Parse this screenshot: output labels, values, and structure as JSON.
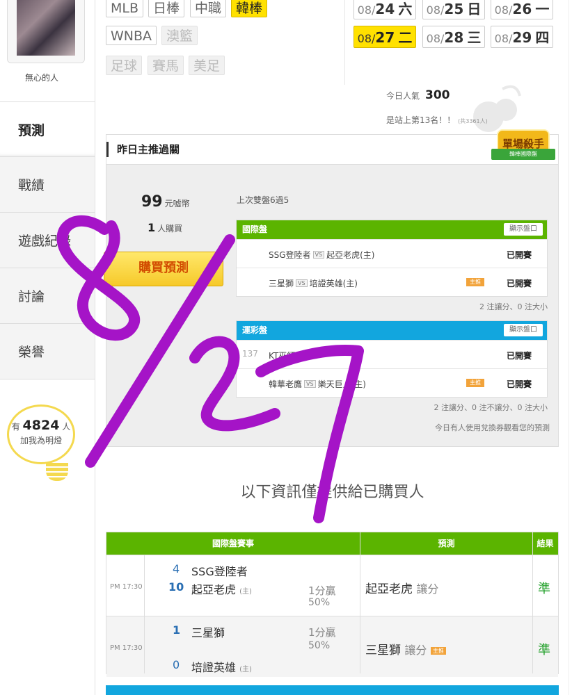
{
  "user": {
    "name": "無心的人"
  },
  "sidebar": {
    "items": [
      {
        "label": "預測"
      },
      {
        "label": "戰績"
      },
      {
        "label": "遊戲紀錄"
      },
      {
        "label": "討論"
      },
      {
        "label": "榮譽"
      }
    ],
    "supporters": {
      "prefix": "有",
      "count": "4824",
      "suffix": "人",
      "text": "加我為明燈"
    }
  },
  "leagues": {
    "row1": [
      "MLB",
      "日棒",
      "中職",
      "韓棒"
    ],
    "row2": [
      "WNBA",
      "澳籃"
    ],
    "row3": [
      "足球",
      "賽馬",
      "美足"
    ],
    "active": "韓棒"
  },
  "dates": [
    {
      "md": "08/",
      "day": "24",
      "wd": "六"
    },
    {
      "md": "08/",
      "day": "25",
      "wd": "日"
    },
    {
      "md": "08/",
      "day": "26",
      "wd": "一"
    },
    {
      "md": "08/",
      "day": "27",
      "wd": "二"
    },
    {
      "md": "08/",
      "day": "28",
      "wd": "三"
    },
    {
      "md": "08/",
      "day": "29",
      "wd": "四"
    }
  ],
  "popularity": {
    "label": "今日人氣",
    "value": "300",
    "rank": "是站上第13名！！",
    "rank_note": "(共3361人)"
  },
  "panel": {
    "title": "昨日主推過關",
    "badge_title": "單場殺手",
    "badge_sub": "韓棒國際盤",
    "coins_value": "99",
    "coins_unit": "元噓幣",
    "buyers_value": "1",
    "buyers_unit": "人購買",
    "buy_button": "購買預測",
    "prev_result": "上次雙盤6過5",
    "show_button": "顯示盤口",
    "intl": {
      "title": "國際盤",
      "rows": [
        {
          "num": "",
          "away": "SSG登陸者",
          "home": "起亞老虎(主)",
          "main": "",
          "status": "已開賽"
        },
        {
          "num": "",
          "away": "三星獅",
          "home": "培證英雄(主)",
          "main": "主推",
          "status": "已開賽"
        }
      ],
      "summary": "2 注讓分、0 注大小"
    },
    "lottery": {
      "title": "運彩盤",
      "rows": [
        {
          "num": "137",
          "away": "KT巫師",
          "home": "",
          "main": "",
          "status": "已開賽"
        },
        {
          "num": "",
          "away": "韓華老鷹",
          "home": "樂天巨人(主)",
          "main": "主推",
          "status": "已開賽"
        }
      ],
      "summary": "2 注讓分、0 注不讓分、0 注大小",
      "note": "今日有人使用兌換券觀看您的預測"
    }
  },
  "purchasers_notice": "以下資訊僅提供給已購買人",
  "bottom_table": {
    "headers": [
      "國際盤賽事",
      "預測",
      "結果"
    ],
    "rows": [
      {
        "time": "PM 17:30",
        "away_score": "4",
        "away": "SSG登陸者",
        "home_score": "10",
        "home": "起亞老虎",
        "home_tag": "(主)",
        "line": "1分贏",
        "pct": "50%",
        "pick": "起亞老虎",
        "pick_type": "讓分",
        "pick_main": "",
        "result": "準"
      },
      {
        "time": "PM 17:30",
        "away_score": "1",
        "away": "三星獅",
        "home_score": "0",
        "home": "培證英雄",
        "home_tag": "(主)",
        "line": "1分贏",
        "pct": "50%",
        "pick": "三星獅",
        "pick_type": "讓分",
        "pick_main": "主推",
        "result": "準"
      }
    ]
  },
  "annotation": {
    "text": "8/27",
    "color": "#a514c7"
  }
}
